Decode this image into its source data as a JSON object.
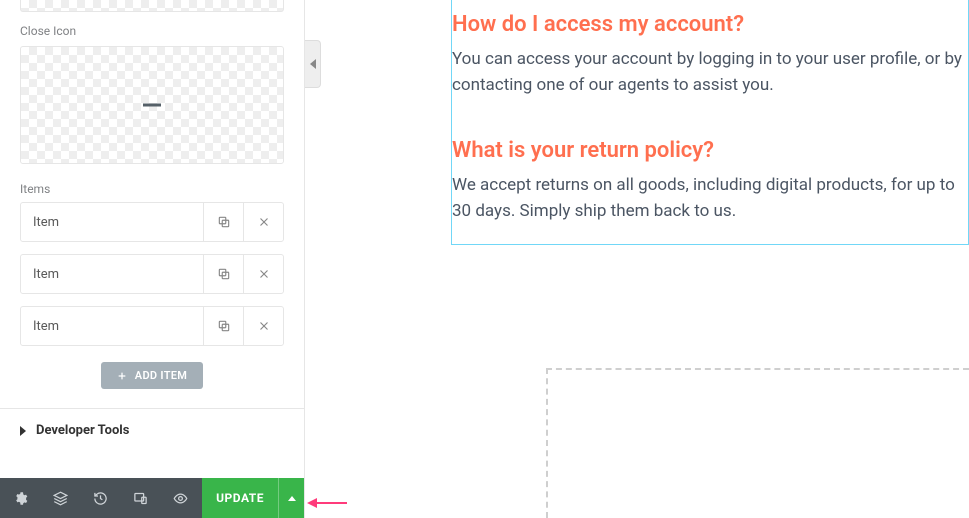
{
  "sidebar": {
    "close_icon_label": "Close Icon",
    "items_label": "Items",
    "rows": [
      {
        "label": "Item"
      },
      {
        "label": "Item"
      },
      {
        "label": "Item"
      }
    ],
    "add_item_label": "ADD ITEM",
    "dev_tools_label": "Developer Tools",
    "update_label": "UPDATE"
  },
  "faq": {
    "q1": "How do I access my account?",
    "a1": "You can access your account by logging in to your user profile, or by contacting one of our agents to assist you.",
    "q2": "What is your return policy?",
    "a2": "We accept returns on all goods, including digital products, for up to 30 days. Simply ship them back to us."
  },
  "colors": {
    "accent": "#ff6f4f",
    "selection": "#71d7f7",
    "update": "#39b54a"
  }
}
